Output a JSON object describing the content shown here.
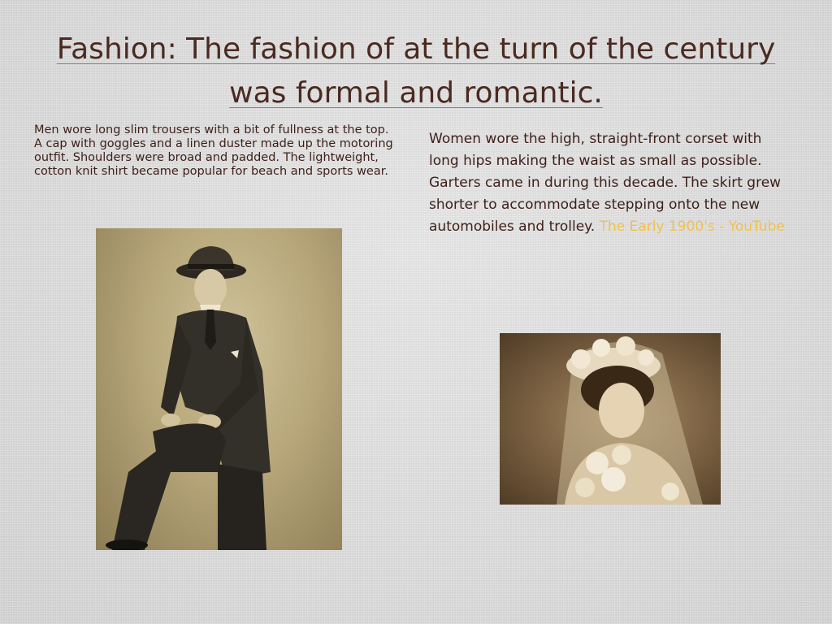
{
  "slide": {
    "title": "Fashion:  The fashion of at the turn of the century was formal and romantic.",
    "men_text": "Men wore long slim trousers with a bit of fullness at the top.  A cap with goggles and a linen duster made up the motoring outfit.  Shoulders were broad and padded.   The lightweight, cotton knit shirt became popular for beach and sports wear.",
    "women_text": "Women wore the high, straight-front corset with long hips making the waist as small as possible.  Garters came in during this decade.  The skirt grew shorter to accommodate stepping onto the new automobiles and trolley. ",
    "women_link": "The Early 1900's - YouTube"
  },
  "colors": {
    "title": "#4a2a20",
    "body_text": "#3d1f18",
    "link": "#f2c14a"
  }
}
